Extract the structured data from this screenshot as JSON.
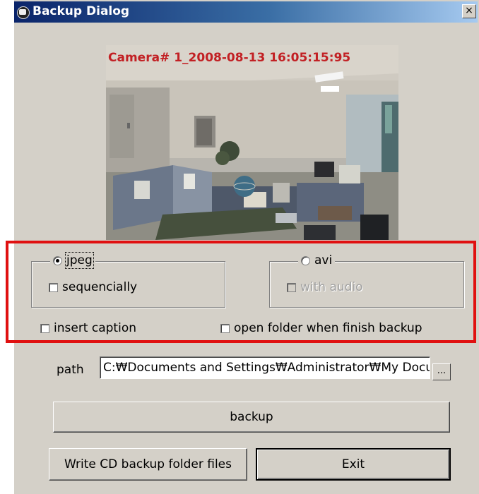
{
  "window": {
    "title": "Backup Dialog",
    "close_label": "×"
  },
  "camera": {
    "caption": "Camera# 1_2008-08-13 16:05:15:95"
  },
  "format": {
    "jpeg_label": "jpeg",
    "jpeg_selected": true,
    "sequencially_label": "sequencially",
    "avi_label": "avi",
    "avi_selected": false,
    "with_audio_label": "with audio"
  },
  "options": {
    "insert_caption_label": "insert caption",
    "open_folder_label": "open folder when finish backup"
  },
  "path": {
    "label": "path",
    "value": "C:₩Documents and Settings₩Administrator₩My Documents",
    "browse_label": "..."
  },
  "buttons": {
    "backup": "backup",
    "write_cd": "Write CD backup folder files",
    "exit": "Exit"
  }
}
